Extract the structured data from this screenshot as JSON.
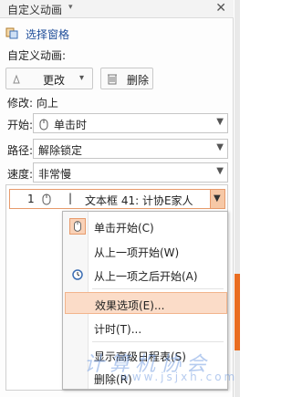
{
  "pane": {
    "title": "自定义动画",
    "title_caret": "▾",
    "close": "✕"
  },
  "selection_pane": {
    "label": "选择窗格"
  },
  "custom_animation": {
    "label": "自定义动画:"
  },
  "toolbar": {
    "change_label": "更改",
    "change_caret": "▾",
    "delete_label": "删除"
  },
  "modify": {
    "label": "修改: 向上"
  },
  "start": {
    "label": "开始:",
    "value": "单击时"
  },
  "path": {
    "label": "路径:",
    "value": "解除锁定"
  },
  "speed": {
    "label": "速度:",
    "value": "非常慢"
  },
  "animation_list": {
    "items": [
      {
        "number": "1",
        "separator": "|",
        "text": "文本框 41: 计协E家人"
      }
    ]
  },
  "context_menu": {
    "items": [
      {
        "label": "单击开始(C)",
        "icon": "mouse-click-icon"
      },
      {
        "label": "从上一项开始(W)",
        "icon": ""
      },
      {
        "label": "从上一项之后开始(A)",
        "icon": "clock-icon"
      },
      {
        "label": "效果选项(E)...",
        "icon": ""
      },
      {
        "label": "计时(T)...",
        "icon": ""
      },
      {
        "label": "显示高级日程表(S)",
        "icon": ""
      },
      {
        "label": "删除(R)",
        "icon": ""
      }
    ]
  },
  "watermark": {
    "text": "计算机协会",
    "url": "www.jsjxh.com"
  },
  "colors": {
    "accent": "#e96d21",
    "highlight": "#fbdcc8",
    "link": "#1f4e9a"
  }
}
